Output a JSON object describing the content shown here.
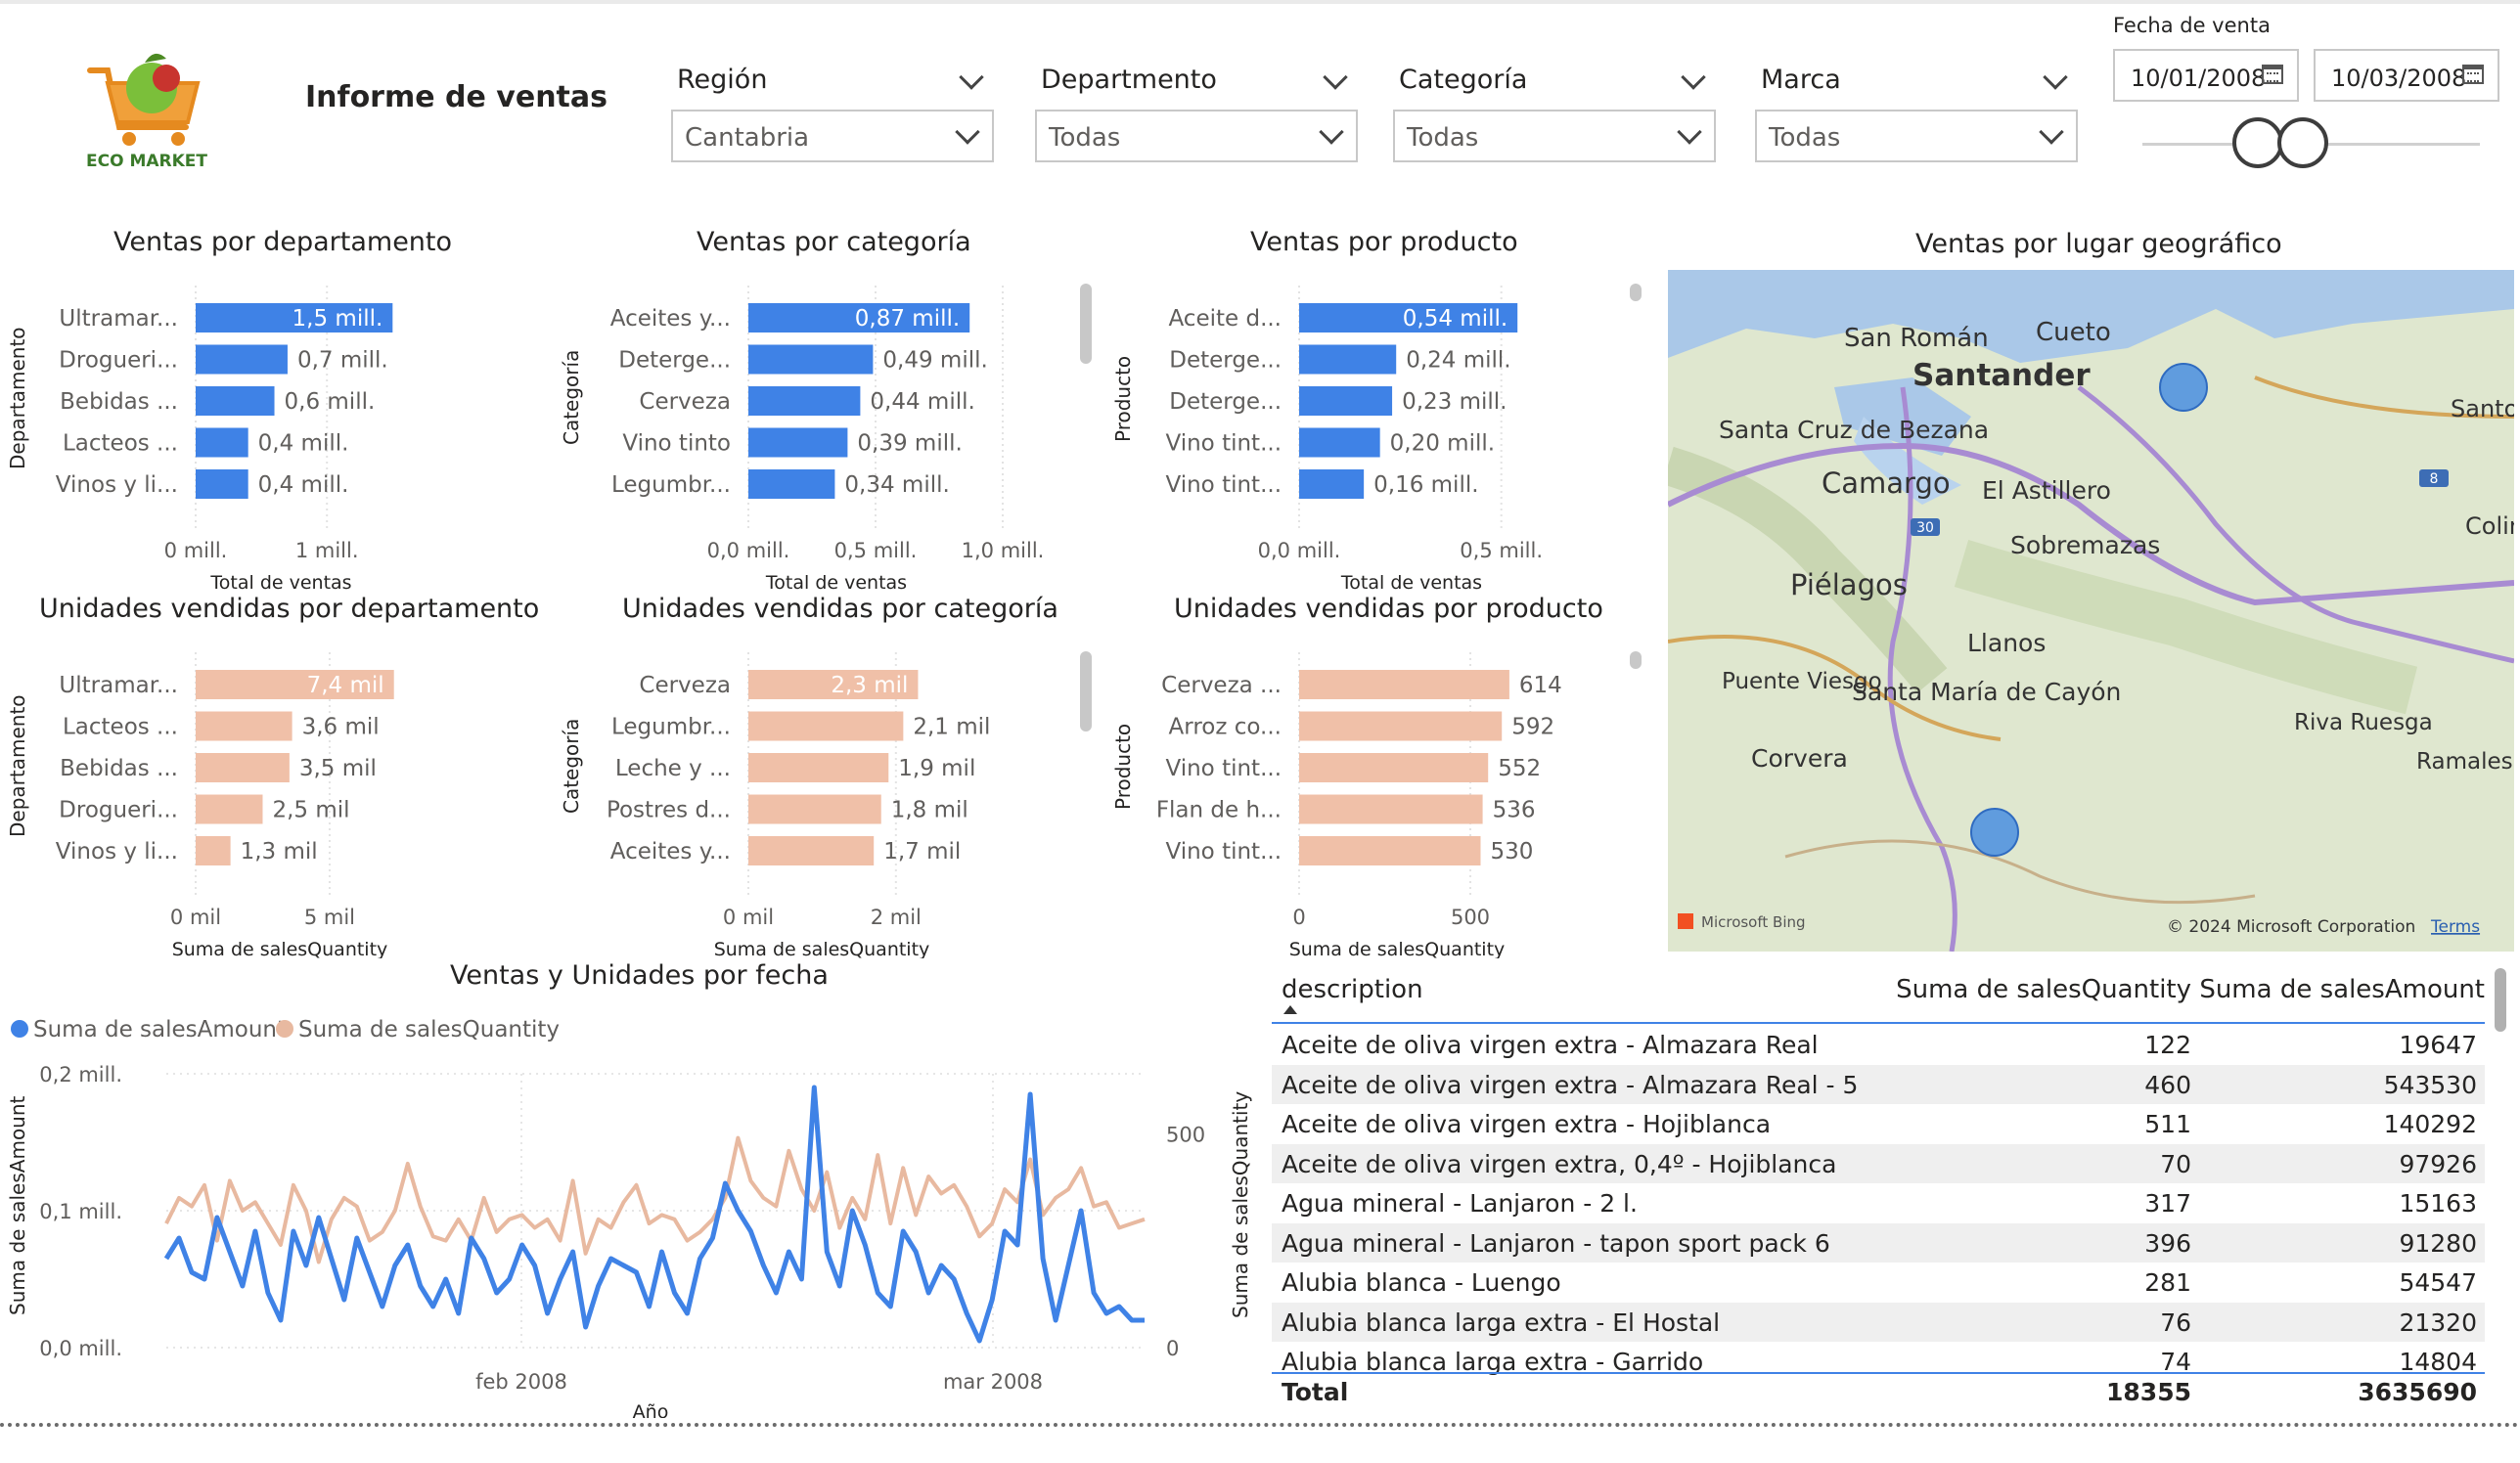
{
  "report": {
    "title": "Informe de ventas",
    "logo_text": "ECO MARKET"
  },
  "filters": [
    {
      "label": "Región",
      "value": "Cantabria"
    },
    {
      "label": "Departmento",
      "value": "Todas"
    },
    {
      "label": "Categoría",
      "value": "Todas"
    },
    {
      "label": "Marca",
      "value": "Todas"
    }
  ],
  "date_filter": {
    "label": "Fecha de venta",
    "start": "10/01/2008",
    "end": "10/03/2008"
  },
  "charts": {
    "dept_sales": {
      "title": "Ventas por departamento",
      "ylabel": "Departamento",
      "xlabel": "Total de ventas",
      "categories": [
        "Ultramar...",
        "Drogueri...",
        "Bebidas ...",
        "Lacteos ...",
        "Vinos y li..."
      ],
      "values": [
        1.5,
        0.7,
        0.6,
        0.4,
        0.4
      ],
      "labels": [
        "1,5 mill.",
        "0,7 mill.",
        "0,6 mill.",
        "0,4 mill.",
        "0,4 mill."
      ],
      "ticks": [
        "0 mill.",
        "1 mill."
      ],
      "tick_values": [
        0,
        1
      ],
      "max": 1.9
    },
    "cat_sales": {
      "title": "Ventas por categoría",
      "ylabel": "Categoría",
      "xlabel": "Total de ventas",
      "categories": [
        "Aceites y...",
        "Deterge...",
        "Cerveza",
        "Vino tinto",
        "Legumbr..."
      ],
      "values": [
        0.87,
        0.49,
        0.44,
        0.39,
        0.34
      ],
      "labels": [
        "0,87 mill.",
        "0,49 mill.",
        "0,44 mill.",
        "0,39 mill.",
        "0,34 mill."
      ],
      "ticks": [
        "0,0 mill.",
        "0,5 mill.",
        "1,0 mill."
      ],
      "tick_values": [
        0,
        0.5,
        1.0
      ],
      "max": 1.0
    },
    "prod_sales": {
      "title": "Ventas por producto",
      "ylabel": "Producto",
      "xlabel": "Total de ventas",
      "categories": [
        "Aceite d...",
        "Deterge...",
        "Deterge...",
        "Vino tint...",
        "Vino tint..."
      ],
      "values": [
        0.54,
        0.24,
        0.23,
        0.2,
        0.16
      ],
      "labels": [
        "0,54 mill.",
        "0,24 mill.",
        "0,23 mill.",
        "0,20 mill.",
        "0,16 mill."
      ],
      "ticks": [
        "0,0 mill.",
        "0,5 mill."
      ],
      "tick_values": [
        0,
        0.5
      ],
      "max": 0.75
    },
    "dept_units": {
      "title": "Unidades vendidas por departamento",
      "ylabel": "Departamento",
      "xlabel": "Suma de salesQuantity",
      "categories": [
        "Ultramar...",
        "Lacteos ...",
        "Bebidas ...",
        "Drogueri...",
        "Vinos y li..."
      ],
      "values": [
        7.4,
        3.6,
        3.5,
        2.5,
        1.3
      ],
      "labels": [
        "7,4 mil",
        "3,6 mil",
        "3,5 mil",
        "2,5 mil",
        "1,3 mil"
      ],
      "ticks": [
        "0 mil",
        "5 mil"
      ],
      "tick_values": [
        0,
        5
      ],
      "max": 9.2
    },
    "cat_units": {
      "title": "Unidades vendidas por categoría",
      "ylabel": "Categoría",
      "xlabel": "Suma de salesQuantity",
      "categories": [
        "Cerveza",
        "Legumbr...",
        "Leche y ...",
        "Postres d...",
        "Aceites y..."
      ],
      "values": [
        2.3,
        2.1,
        1.9,
        1.8,
        1.7
      ],
      "labels": [
        "2,3 mil",
        "2,1 mil",
        "1,9 mil",
        "1,8 mil",
        "1,7 mil"
      ],
      "ticks": [
        "0 mil",
        "2 mil"
      ],
      "tick_values": [
        0,
        2
      ],
      "max": 3.05
    },
    "prod_units": {
      "title": "Unidades vendidas por producto",
      "ylabel": "Producto",
      "xlabel": "Suma de salesQuantity",
      "categories": [
        "Cerveza ...",
        "Arroz co...",
        "Vino tint...",
        "Flan de h...",
        "Vino tint..."
      ],
      "values": [
        614,
        592,
        552,
        536,
        530
      ],
      "labels": [
        "614",
        "592",
        "552",
        "536",
        "530"
      ],
      "ticks": [
        "0",
        "500"
      ],
      "tick_values": [
        0,
        500
      ],
      "max": 800
    }
  },
  "map": {
    "title": "Ventas por lugar geográfico",
    "places": [
      "San Román",
      "Cueto",
      "Santander",
      "Santa Cruz de Bezana",
      "Camargo",
      "El Astillero",
      "Sobremazas",
      "Piélagos",
      "Llanos",
      "Puente Viesgo",
      "Santa María de Cayón",
      "Corvera",
      "Riva Ruesga",
      "Ramales la Victo",
      "Santo",
      "Colin"
    ],
    "road_badges": [
      "30",
      "8"
    ],
    "attribution": "© 2024 Microsoft Corporation",
    "terms": "Terms",
    "bing": "Microsoft Bing"
  },
  "chart_data": {
    "type": "line",
    "title": "Ventas y Unidades por fecha",
    "xlabel": "Año",
    "ylabel": "Suma de salesAmount",
    "y2label": "Suma de salesQuantity",
    "x_ticks": [
      "feb 2008",
      "mar 2008"
    ],
    "y_ticks": [
      "0,0 mill.",
      "0,1 mill.",
      "0,2 mill."
    ],
    "y2_ticks": [
      "0",
      "500"
    ],
    "ylim": [
      0,
      0.2
    ],
    "y2lim": [
      0,
      640
    ],
    "series": [
      {
        "name": "Suma de salesAmount",
        "color": "#3f82e6",
        "values": [
          0.065,
          0.08,
          0.055,
          0.05,
          0.095,
          0.07,
          0.045,
          0.085,
          0.04,
          0.02,
          0.085,
          0.06,
          0.095,
          0.065,
          0.035,
          0.08,
          0.055,
          0.03,
          0.06,
          0.075,
          0.045,
          0.03,
          0.05,
          0.025,
          0.08,
          0.065,
          0.04,
          0.05,
          0.075,
          0.06,
          0.025,
          0.05,
          0.07,
          0.015,
          0.045,
          0.065,
          0.06,
          0.055,
          0.03,
          0.07,
          0.04,
          0.025,
          0.065,
          0.08,
          0.12,
          0.1,
          0.085,
          0.06,
          0.04,
          0.07,
          0.05,
          0.19,
          0.07,
          0.045,
          0.1,
          0.075,
          0.04,
          0.03,
          0.085,
          0.07,
          0.04,
          0.06,
          0.05,
          0.025,
          0.005,
          0.035,
          0.085,
          0.075,
          0.185,
          0.065,
          0.02,
          0.06,
          0.1,
          0.04,
          0.025,
          0.03,
          0.02,
          0.02
        ]
      },
      {
        "name": "Suma de salesQuantity",
        "color": "#e8b9a0",
        "values": [
          290,
          350,
          330,
          380,
          250,
          390,
          320,
          340,
          290,
          240,
          380,
          320,
          200,
          300,
          350,
          330,
          250,
          270,
          320,
          430,
          330,
          260,
          250,
          300,
          250,
          350,
          270,
          300,
          310,
          280,
          300,
          250,
          390,
          220,
          300,
          280,
          340,
          380,
          290,
          310,
          300,
          250,
          270,
          300,
          350,
          490,
          390,
          350,
          330,
          460,
          370,
          320,
          410,
          280,
          350,
          300,
          450,
          290,
          420,
          310,
          400,
          360,
          380,
          330,
          260,
          290,
          370,
          340,
          440,
          310,
          350,
          370,
          420,
          330,
          340,
          280,
          290,
          300
        ]
      }
    ]
  },
  "table": {
    "columns": [
      "description",
      "Suma de salesQuantity",
      "Suma de salesAmount"
    ],
    "rows": [
      [
        "Aceite de oliva virgen extra - Almazara Real",
        "122",
        "19647"
      ],
      [
        "Aceite de oliva virgen extra - Almazara Real - 5",
        "460",
        "543530"
      ],
      [
        "Aceite de oliva virgen extra - Hojiblanca",
        "511",
        "140292"
      ],
      [
        "Aceite de oliva virgen extra, 0,4º - Hojiblanca",
        "70",
        "97926"
      ],
      [
        "Agua mineral - Lanjaron - 2 l.",
        "317",
        "15163"
      ],
      [
        "Agua mineral - Lanjaron - tapon sport pack 6",
        "396",
        "91280"
      ],
      [
        "Alubia blanca - Luengo",
        "281",
        "54547"
      ],
      [
        "Alubia blanca larga extra - El Hostal",
        "76",
        "21320"
      ],
      [
        "Alubia blanca larga extra - Garrido",
        "74",
        "14804"
      ]
    ],
    "total": [
      "Total",
      "18355",
      "3635690"
    ]
  },
  "colors": {
    "accent": "#3f82e6",
    "units": "#f0c0a8",
    "units_line": "#e8b9a0",
    "map_marker": "#4a8ee0"
  }
}
